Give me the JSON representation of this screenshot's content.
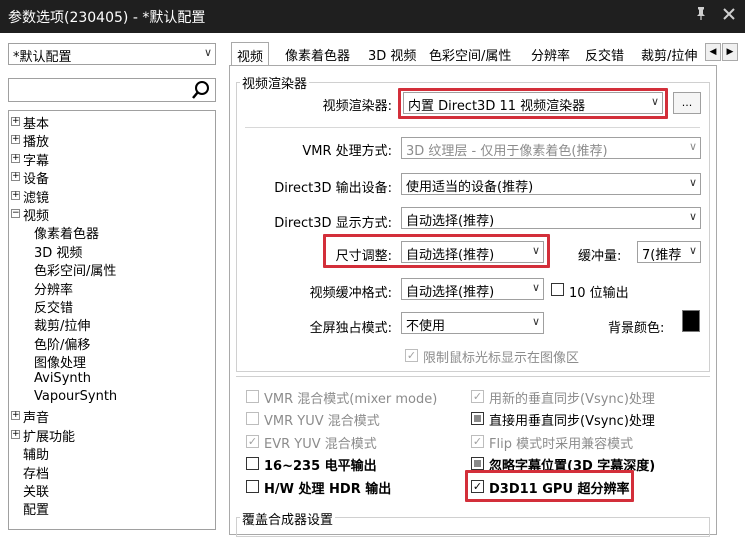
{
  "window": {
    "title": "参数选项(230405) - *默认配置",
    "pin_icon": "pin-icon",
    "close_icon": "close-icon"
  },
  "profile_select": {
    "value": "*默认配置"
  },
  "search": {
    "placeholder": "",
    "icon": "search-icon"
  },
  "tree": {
    "items": [
      {
        "label": "基本",
        "expandable": true
      },
      {
        "label": "播放",
        "expandable": true
      },
      {
        "label": "字幕",
        "expandable": true
      },
      {
        "label": "设备",
        "expandable": true
      },
      {
        "label": "滤镜",
        "expandable": true
      },
      {
        "label": "视频",
        "expandable": true,
        "expanded": true
      },
      {
        "label": "像素着色器",
        "child": true
      },
      {
        "label": "3D 视频",
        "child": true
      },
      {
        "label": "色彩空间/属性",
        "child": true
      },
      {
        "label": "分辨率",
        "child": true
      },
      {
        "label": "反交错",
        "child": true
      },
      {
        "label": "裁剪/拉伸",
        "child": true
      },
      {
        "label": "色阶/偏移",
        "child": true
      },
      {
        "label": "图像处理",
        "child": true
      },
      {
        "label": "AviSynth",
        "child": true
      },
      {
        "label": "VapourSynth",
        "child": true
      },
      {
        "label": "声音",
        "expandable": true
      },
      {
        "label": "扩展功能",
        "expandable": true
      },
      {
        "label": "辅助"
      },
      {
        "label": "存档"
      },
      {
        "label": "关联"
      },
      {
        "label": "配置"
      }
    ]
  },
  "tabs": [
    "视频",
    "像素着色器",
    "3D 视频",
    "色彩空间/属性",
    "分辨率",
    "反交错",
    "裁剪/拉伸"
  ],
  "tab_scroll": {
    "left": "◀",
    "right": "▶"
  },
  "renderer_group": {
    "title": "视频渲染器",
    "renderer_label": "视频渲染器:",
    "renderer_value": "内置 Direct3D 11 视频渲染器",
    "settings_button": "...",
    "vmr_label": "VMR 处理方式:",
    "vmr_value": "3D 纹理层 - 仅用于像素着色(推荐)",
    "d3d_device_label": "Direct3D 输出设备:",
    "d3d_device_value": "使用适当的设备(推荐)",
    "d3d_display_label": "Direct3D 显示方式:",
    "d3d_display_value": "自动选择(推荐)",
    "resize_label": "尺寸调整:",
    "resize_value": "自动选择(推荐)",
    "buffer_label": "缓冲量:",
    "buffer_value": "7(推荐",
    "buffer_format_label": "视频缓冲格式:",
    "buffer_format_value": "自动选择(推荐)",
    "ten_bit_label": "10 位输出",
    "fullscreen_label": "全屏独占模式:",
    "fullscreen_value": "不使用",
    "bgcolor_label": "背景颜色:",
    "bgcolor_value": "#000000",
    "limit_cursor_label": "限制鼠标光标显示在图像区"
  },
  "options": {
    "left": [
      {
        "label": "VMR 混合模式(mixer mode)",
        "checked": false,
        "disabled": true
      },
      {
        "label": "VMR YUV 混合模式",
        "checked": false,
        "disabled": true
      },
      {
        "label": "EVR YUV 混合模式",
        "checked": true,
        "disabled": true
      },
      {
        "label": "16~235 电平输出",
        "checked": false,
        "disabled": false
      },
      {
        "label": "H/W 处理 HDR 输出",
        "checked": false,
        "disabled": false
      }
    ],
    "right": [
      {
        "label": "用新的垂直同步(Vsync)处理",
        "checked": true,
        "disabled": true
      },
      {
        "label": "直接用垂直同步(Vsync)处理",
        "state": "indeterminate",
        "disabled": false
      },
      {
        "label": "Flip 模式时采用兼容模式",
        "checked": true,
        "disabled": true
      },
      {
        "label": "忽略字幕位置(3D 字幕深度)",
        "state": "indeterminate",
        "disabled": false
      },
      {
        "label": "D3D11 GPU 超分辨率",
        "checked": true,
        "disabled": false
      }
    ]
  },
  "overlay_group": {
    "title": "覆盖合成器设置"
  },
  "colors": {
    "highlight": "#d32f3a",
    "titlebar": "#1f1f1f"
  }
}
